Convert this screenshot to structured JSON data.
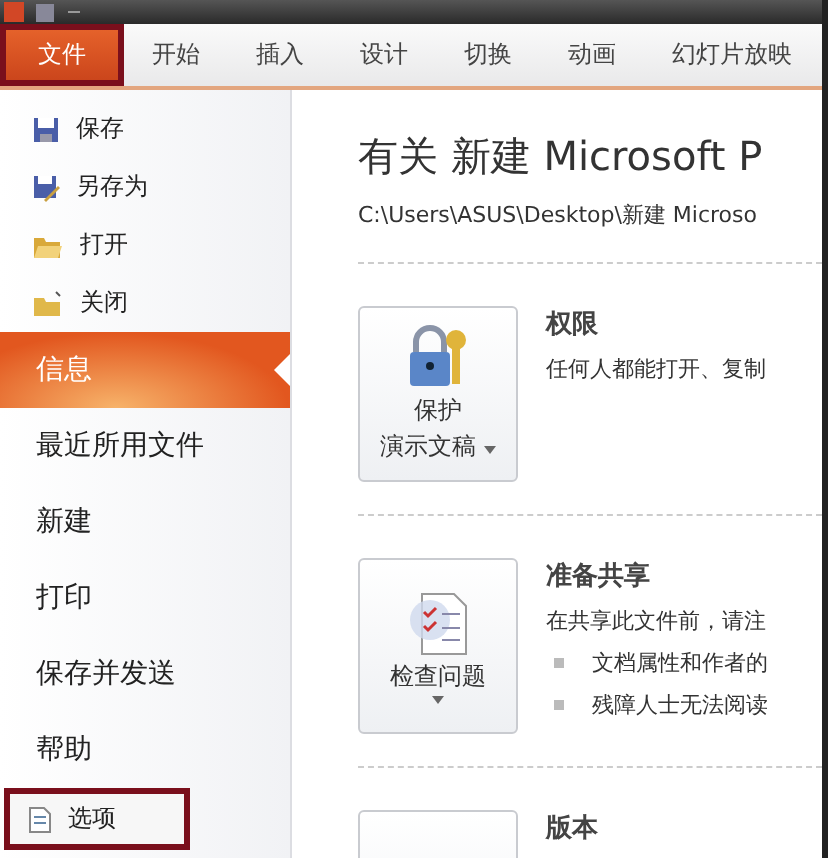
{
  "ribbon_tabs": [
    {
      "label": "文件",
      "selected": true,
      "highlighted": true
    },
    {
      "label": "开始",
      "selected": false,
      "highlighted": false
    },
    {
      "label": "插入",
      "selected": false,
      "highlighted": false
    },
    {
      "label": "设计",
      "selected": false,
      "highlighted": false
    },
    {
      "label": "切换",
      "selected": false,
      "highlighted": false
    },
    {
      "label": "动画",
      "selected": false,
      "highlighted": false
    },
    {
      "label": "幻灯片放映",
      "selected": false,
      "highlighted": false
    }
  ],
  "sidebar": {
    "items": [
      {
        "kind": "command",
        "label": "保存",
        "selected": false,
        "highlighted": false
      },
      {
        "kind": "command",
        "label": "另存为",
        "selected": false,
        "highlighted": false
      },
      {
        "kind": "command",
        "label": "打开",
        "selected": false,
        "highlighted": false
      },
      {
        "kind": "command",
        "label": "关闭",
        "selected": false,
        "highlighted": false
      },
      {
        "kind": "page",
        "label": "信息",
        "selected": true,
        "highlighted": false
      },
      {
        "kind": "page",
        "label": "最近所用文件",
        "selected": false,
        "highlighted": false
      },
      {
        "kind": "page",
        "label": "新建",
        "selected": false,
        "highlighted": false
      },
      {
        "kind": "page",
        "label": "打印",
        "selected": false,
        "highlighted": false
      },
      {
        "kind": "page",
        "label": "保存并发送",
        "selected": false,
        "highlighted": false
      },
      {
        "kind": "page",
        "label": "帮助",
        "selected": false,
        "highlighted": false
      },
      {
        "kind": "command",
        "label": "选项",
        "selected": false,
        "highlighted": true
      }
    ]
  },
  "info": {
    "title": "有关 新建 Microsoft P",
    "path": "C:\\Users\\ASUS\\Desktop\\新建 Microso",
    "sections": [
      {
        "button_lines": [
          "保护",
          "演示文稿"
        ],
        "dropdown": true,
        "heading": "权限",
        "description": "任何人都能打开、复制"
      },
      {
        "button_lines": [
          "检查问题"
        ],
        "dropdown": true,
        "heading": "准备共享",
        "description": "在共享此文件前，请注",
        "bullets": [
          "文档属性和作者的",
          "残障人士无法阅读"
        ]
      },
      {
        "heading": "版本"
      }
    ]
  }
}
